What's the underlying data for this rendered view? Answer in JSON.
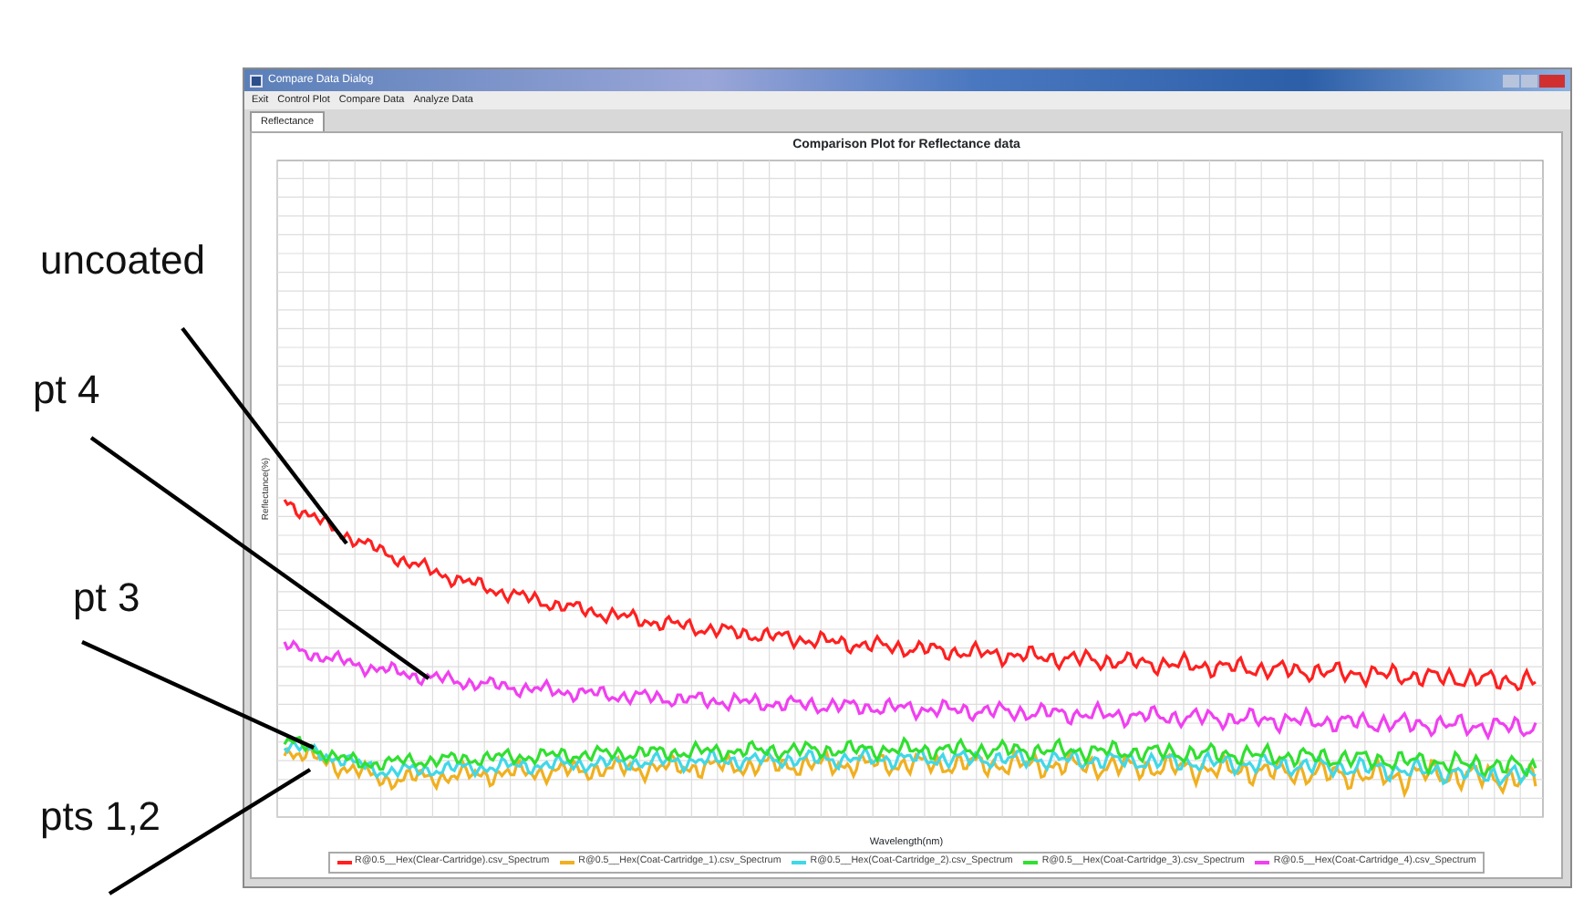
{
  "window": {
    "title": "Compare Data Dialog"
  },
  "menu": [
    "Exit",
    "Control Plot",
    "Compare Data",
    "Analyze Data"
  ],
  "tabs": [
    {
      "label": "Reflectance",
      "selected": true
    }
  ],
  "plot": {
    "title": "Comparison Plot for Reflectance data",
    "xlabel": "Wavelength(nm)",
    "ylabel": "Reflectance(%)",
    "legend": [
      {
        "label": "R@0.5__Hex(Clear-Cartridge).csv_Spectrum",
        "color": "#ff2020"
      },
      {
        "label": "R@0.5__Hex(Coat-Cartridge_1).csv_Spectrum",
        "color": "#f0b020"
      },
      {
        "label": "R@0.5__Hex(Coat-Cartridge_2).csv_Spectrum",
        "color": "#40d8e8"
      },
      {
        "label": "R@0.5__Hex(Coat-Cartridge_3).csv_Spectrum",
        "color": "#30e030"
      },
      {
        "label": "R@0.5__Hex(Coat-Cartridge_4).csv_Spectrum",
        "color": "#f040f0"
      }
    ]
  },
  "annotations": [
    "uncoated",
    "pt 4",
    "pt 3",
    "pts 1,2"
  ]
}
